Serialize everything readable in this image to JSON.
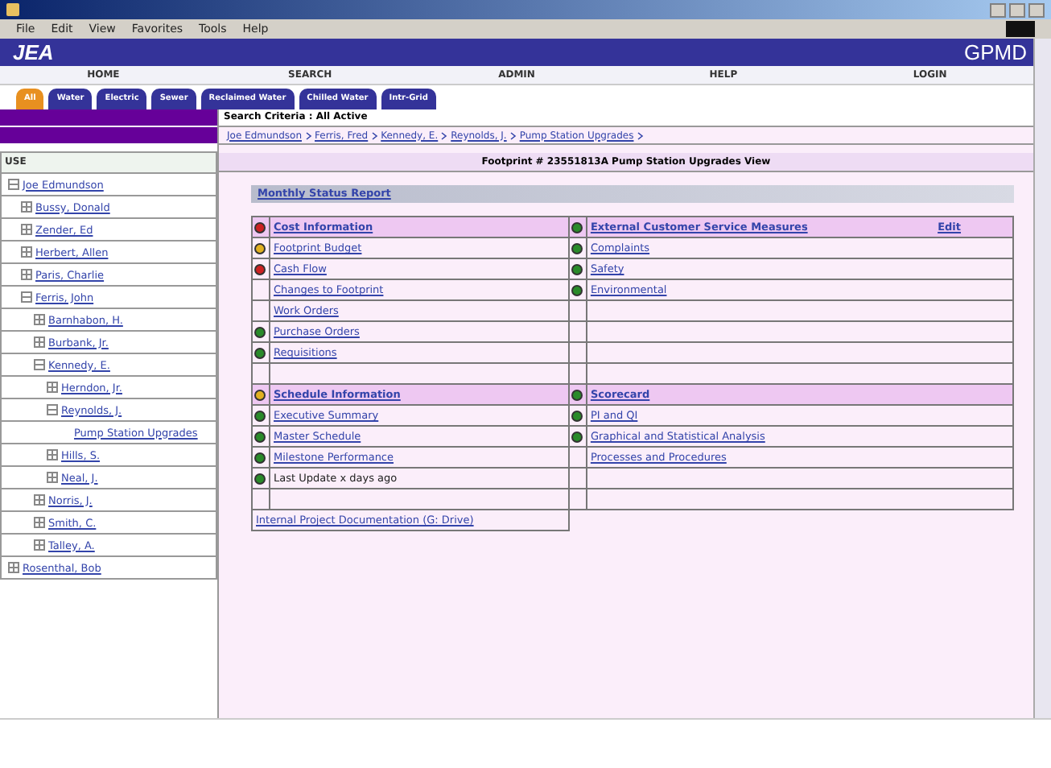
{
  "menu": [
    "File",
    "Edit",
    "View",
    "Favorites",
    "Tools",
    "Help"
  ],
  "banner": {
    "logo": "JEA",
    "app": "GPMD"
  },
  "nav": [
    "HOME",
    "SEARCH",
    "ADMIN",
    "HELP",
    "LOGIN"
  ],
  "tabs": [
    {
      "label": "All",
      "selected": true
    },
    {
      "label": "Water",
      "selected": false
    },
    {
      "label": "Electric",
      "selected": false
    },
    {
      "label": "Sewer",
      "selected": false
    },
    {
      "label": "Reclaimed Water",
      "selected": false
    },
    {
      "label": "Chilled Water",
      "selected": false
    },
    {
      "label": "Intr-Grid",
      "selected": false
    }
  ],
  "search_criteria": "Search Criteria : All Active",
  "breadcrumb": [
    "Joe Edmundson",
    "Ferris, Fred",
    "Kennedy, E.",
    "Reynolds, J.",
    "Pump Station Upgrades"
  ],
  "sidebar": {
    "header": "USE",
    "tree": [
      {
        "label": "Joe Edmundson",
        "expanded": true,
        "children": [
          {
            "label": "Bussy, Donald",
            "expanded": false
          },
          {
            "label": "Zender, Ed",
            "expanded": false
          },
          {
            "label": "Herbert, Allen",
            "expanded": false
          },
          {
            "label": "Paris, Charlie",
            "expanded": false
          },
          {
            "label": "Ferris, John",
            "expanded": true,
            "children": [
              {
                "label": "Barnhabon, H.",
                "expanded": false
              },
              {
                "label": "Burbank, Jr.",
                "expanded": false
              },
              {
                "label": "Kennedy, E.",
                "expanded": true,
                "children": [
                  {
                    "label": "Herndon, Jr.",
                    "expanded": false
                  },
                  {
                    "label": "Reynolds, J.",
                    "expanded": true,
                    "children": [
                      {
                        "label": "Pump Station Upgrades"
                      }
                    ]
                  },
                  {
                    "label": "Hills, S.",
                    "expanded": false
                  },
                  {
                    "label": "Neal, J.",
                    "expanded": false
                  }
                ]
              },
              {
                "label": "Norris, J.",
                "expanded": false
              },
              {
                "label": "Smith, C.",
                "expanded": false
              },
              {
                "label": "Talley, A.",
                "expanded": false
              }
            ]
          }
        ]
      },
      {
        "label": "Rosenthal, Bob",
        "expanded": false
      }
    ]
  },
  "footprint_title": "Footprint # 23551813A   Pump Station Upgrades View",
  "report": {
    "title": "Monthly Status Report",
    "sections": [
      {
        "left": {
          "heading": {
            "label": "Cost Information",
            "color": "#cc2222"
          },
          "rows": [
            {
              "label": "Footprint Budget",
              "color": "#e0b020"
            },
            {
              "label": "Cash Flow",
              "color": "#cc2222"
            },
            {
              "label": "Changes to Footprint"
            },
            {
              "label": "Work Orders"
            },
            {
              "label": "Purchase Orders",
              "color": "#2a8a2a"
            },
            {
              "label": "Requisitions",
              "color": "#2a8a2a"
            }
          ]
        },
        "right": {
          "heading": {
            "label": "External Customer Service Measures",
            "color": "#2a8a2a",
            "action": "Edit"
          },
          "rows": [
            {
              "label": "Complaints",
              "color": "#2a8a2a"
            },
            {
              "label": "Safety",
              "color": "#2a8a2a"
            },
            {
              "label": "Environmental",
              "color": "#2a8a2a"
            }
          ]
        }
      },
      {
        "left": {
          "heading": {
            "label": "Schedule Information",
            "color": "#e0b020"
          },
          "rows": [
            {
              "label": "Executive Summary",
              "color": "#2a8a2a"
            },
            {
              "label": "Master Schedule",
              "color": "#2a8a2a"
            },
            {
              "label": "Milestone Performance",
              "color": "#2a8a2a"
            },
            {
              "label": "Last Update x days ago",
              "color": "#2a8a2a",
              "kind": "text"
            }
          ]
        },
        "right": {
          "heading": {
            "label": "Scorecard",
            "color": "#2a8a2a"
          },
          "rows": [
            {
              "label": "PI and QI",
              "color": "#2a8a2a"
            },
            {
              "label": "Graphical and Statistical Analysis",
              "color": "#2a8a2a"
            },
            {
              "label": "Processes and Procedures"
            }
          ]
        }
      }
    ],
    "footer_link": "Internal Project Documentation (G: Drive)"
  }
}
